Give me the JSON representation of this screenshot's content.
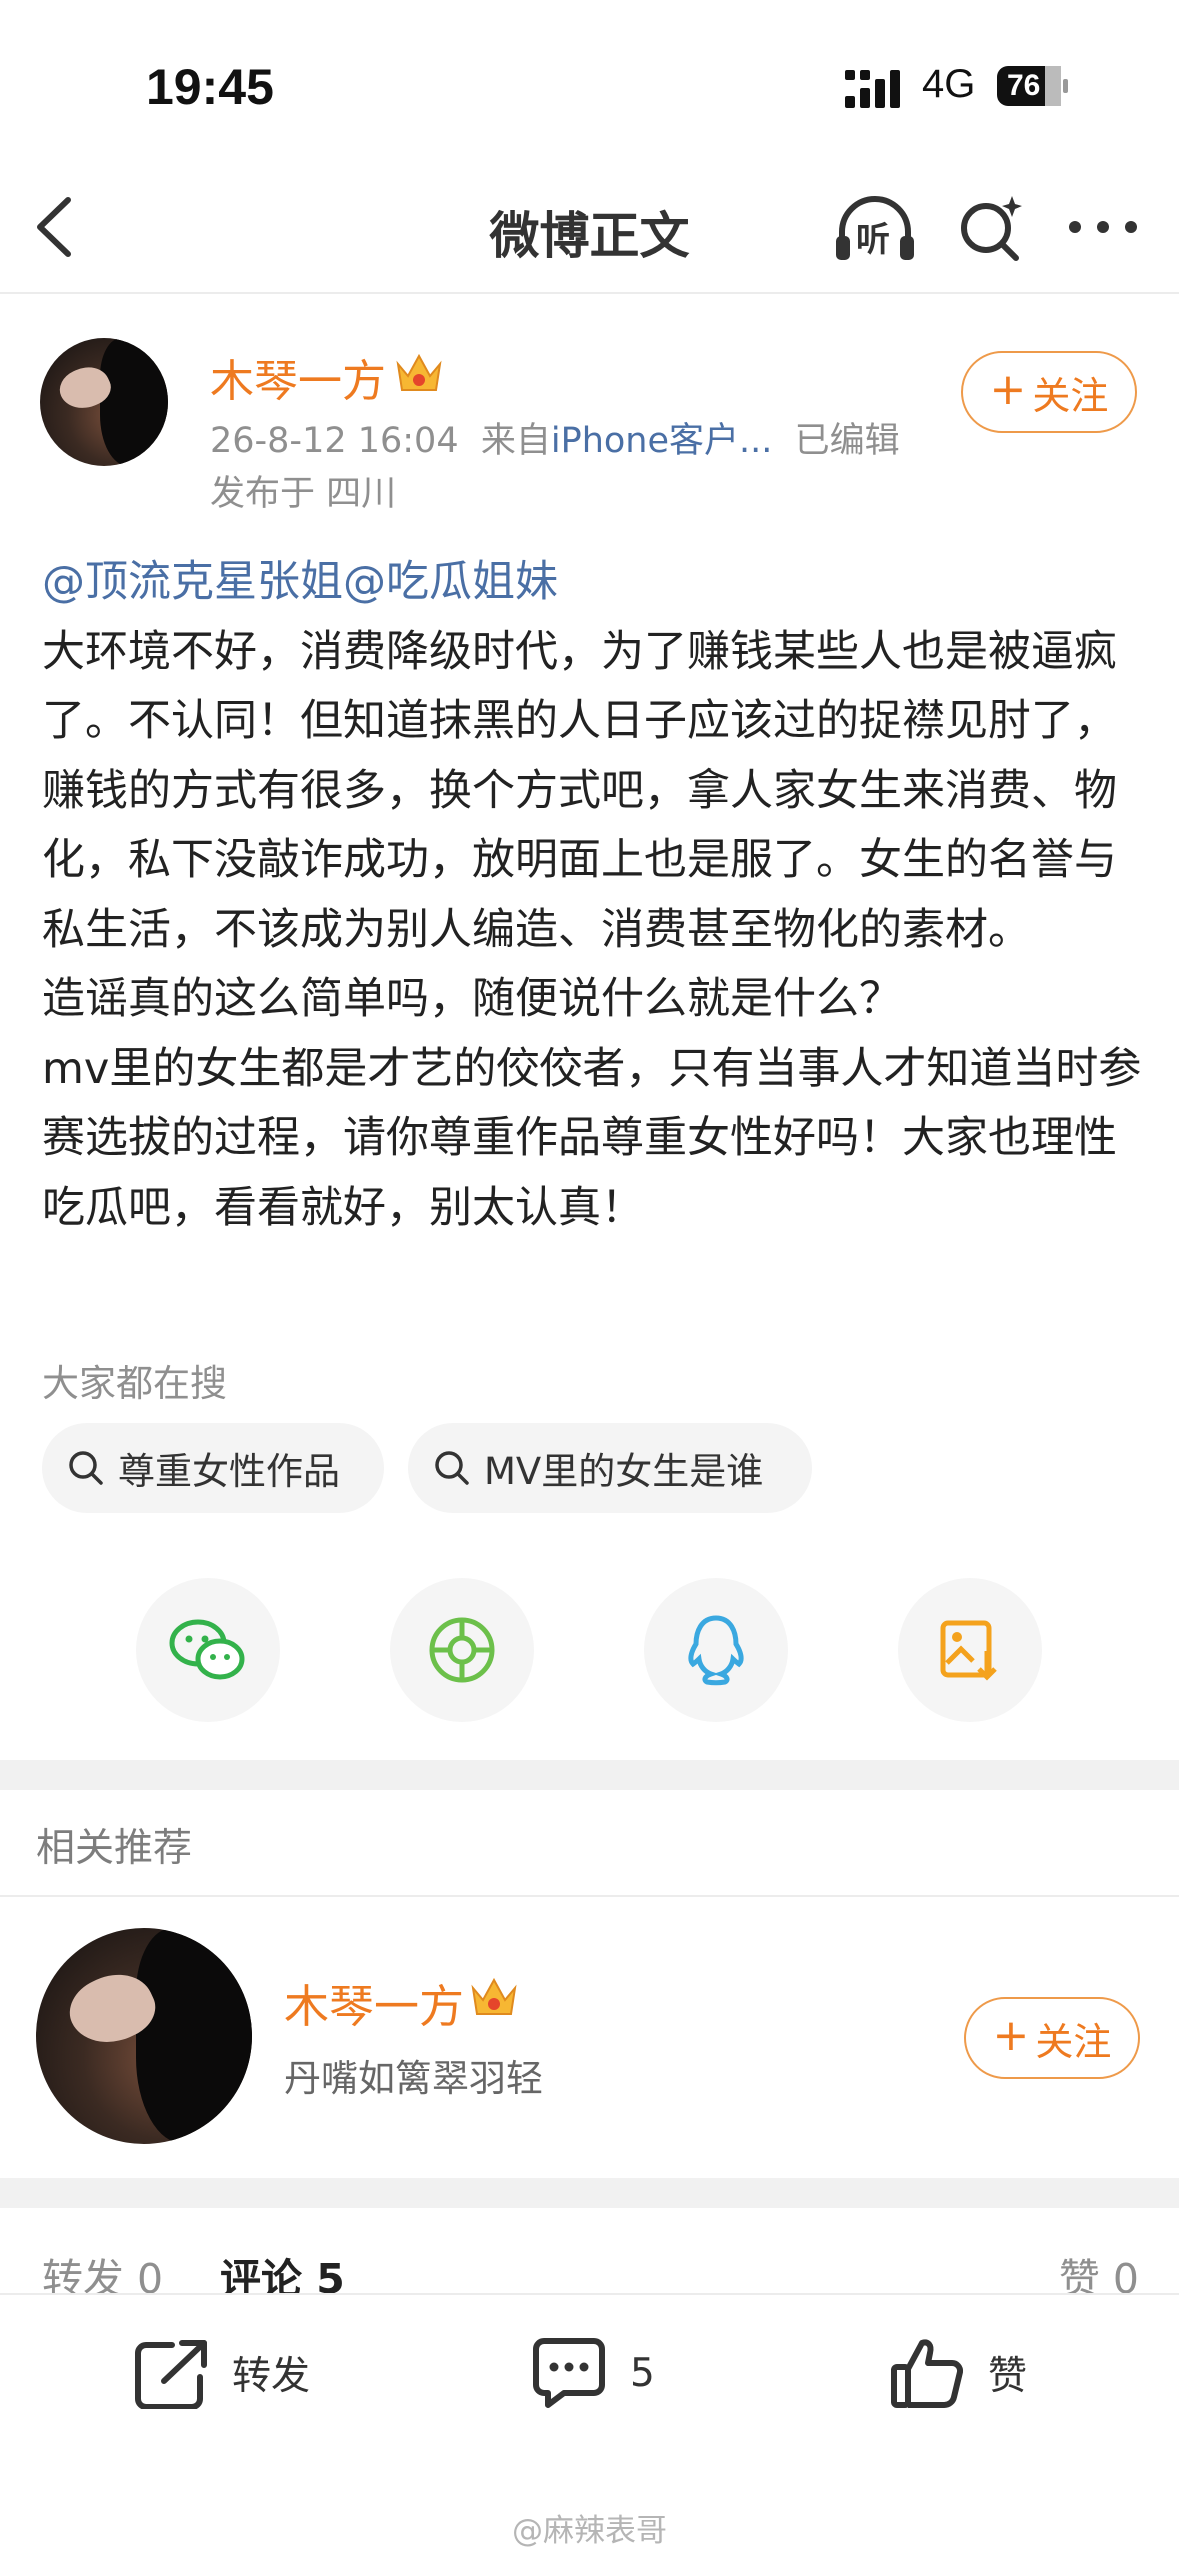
{
  "status_bar": {
    "time": "19:45",
    "network": "4G",
    "battery": "76",
    "icons": [
      "signal-icon",
      "battery-icon"
    ]
  },
  "nav": {
    "title": "微博正文",
    "icons": [
      "back-icon",
      "listen-icon",
      "search-icon",
      "more-icon"
    ],
    "listen_label": "听"
  },
  "post": {
    "author": "木琴一方",
    "date": "26-8-12 16:04",
    "source_prefix": "来自",
    "source": "iPhone客户...",
    "edited": "已编辑",
    "location": "发布于 四川",
    "follow_label": "关注",
    "mentions": [
      "@顶流克星张姐",
      "@吃瓜姐妹"
    ],
    "paragraphs": [
      "大环境不好，消费降级时代，为了赚钱某些人也是被逼疯了。不认同！但知道抹黑的人日子应该过的捉襟见肘了，赚钱的方式有很多，换个方式吧，拿人家女生来消费、物化，私下没敲诈成功，放明面上也是服了。女生的名誉与私生活，不该成为别人编造、消费甚至物化的素材。",
      "造谣真的这么简单吗，随便说什么就是什么？",
      "mv里的女生都是才艺的佼佼者，只有当事人才知道当时参赛选拔的过程，请你尊重作品尊重女性好吗！大家也理性吃瓜吧，看看就好，别太认真！"
    ]
  },
  "hot_search": {
    "label": "大家都在搜",
    "chips": [
      "尊重女性作品",
      "MV里的女生是谁"
    ]
  },
  "share": {
    "icons": [
      "wechat-icon",
      "moments-icon",
      "qq-icon",
      "save-image-icon"
    ],
    "colors": {
      "wechat": "#33b24b",
      "moments": "#6cc04a",
      "qq": "#3aa8e0",
      "save": "#f4a21d"
    }
  },
  "related": {
    "title": "相关推荐",
    "name": "木琴一方",
    "desc": "丹嘴如篱翠羽轻",
    "follow_label": "关注"
  },
  "tabs": {
    "repost": "转发 0",
    "comment": "评论 5",
    "like": "赞 0"
  },
  "bottom_bar": {
    "repost": "转发",
    "comment": "5",
    "like": "赞"
  },
  "watermark": "@麻辣表哥",
  "accent_color": "#ee7a20"
}
